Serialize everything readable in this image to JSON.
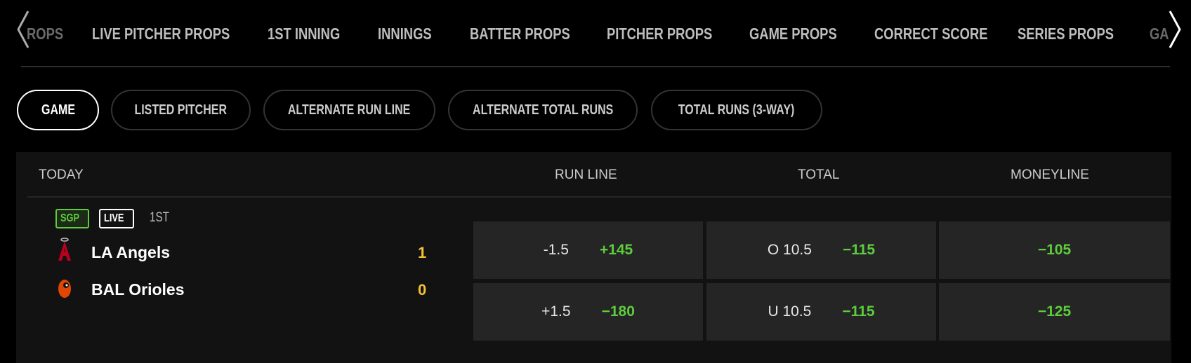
{
  "nav": {
    "items": [
      "ROPS",
      "LIVE PITCHER PROPS",
      "1ST INNING",
      "INNINGS",
      "BATTER PROPS",
      "PITCHER PROPS",
      "GAME PROPS",
      "CORRECT SCORE",
      "SERIES PROPS",
      "GA"
    ],
    "prev_icon": "chevron-left-icon",
    "next_icon": "chevron-right-icon"
  },
  "pills": [
    {
      "label": "GAME",
      "active": true
    },
    {
      "label": "LISTED PITCHER"
    },
    {
      "label": "ALTERNATE RUN LINE"
    },
    {
      "label": "ALTERNATE TOTAL RUNS"
    },
    {
      "label": "TOTAL RUNS (3-WAY)"
    }
  ],
  "table": {
    "section": "TODAY",
    "columns": [
      "RUN LINE",
      "TOTAL",
      "MONEYLINE"
    ],
    "badges": {
      "sgp": "SGP",
      "live": "LIVE",
      "inning": "1ST"
    },
    "teams": [
      {
        "name": "LA Angels",
        "score": "1",
        "run_line": "-1.5",
        "run_line_odds": "+145",
        "total": "O 10.5",
        "total_odds": "−115",
        "moneyline": "−105"
      },
      {
        "name": "BAL Orioles",
        "score": "0",
        "run_line": "+1.5",
        "run_line_odds": "−180",
        "total": "U 10.5",
        "total_odds": "−115",
        "moneyline": "−125"
      }
    ]
  },
  "colors": {
    "odds": "#5ccd3c",
    "score": "#f2c230",
    "sgp": "#5ccd3c"
  }
}
